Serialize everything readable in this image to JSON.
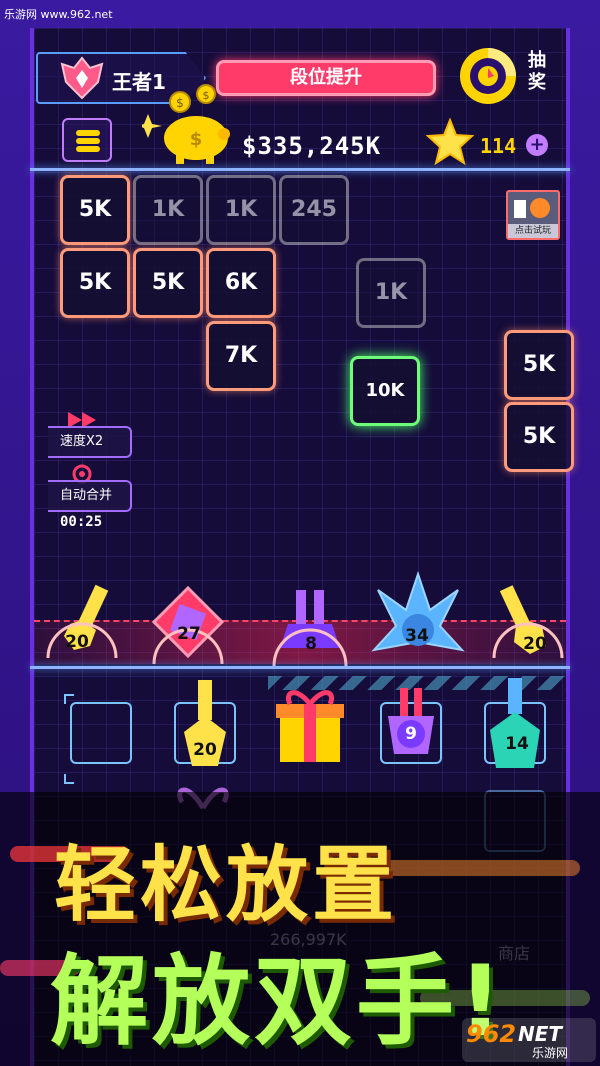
{
  "watermark_top": "乐游网 www.962.net",
  "header": {
    "rank_label": "王者1",
    "rank_up_button": "段位提升",
    "lottery_label": "抽奖",
    "money": "$335,245K",
    "gem_count": "114",
    "plus": "+"
  },
  "trial": {
    "label": "点击试玩"
  },
  "blocks": [
    {
      "label": "5K"
    },
    {
      "label": "1K"
    },
    {
      "label": "1K"
    },
    {
      "label": "245"
    },
    {
      "label": "5K"
    },
    {
      "label": "5K"
    },
    {
      "label": "6K"
    },
    {
      "label": "1K"
    },
    {
      "label": "7K"
    },
    {
      "label": "10K"
    },
    {
      "label": "5K"
    },
    {
      "label": "5K"
    }
  ],
  "side": {
    "speed_label": "速度X2",
    "auto_merge_label": "自动合并",
    "timer": "00:25"
  },
  "turrets": [
    {
      "level": "20"
    },
    {
      "level": "27"
    },
    {
      "level": "8"
    },
    {
      "level": "34"
    },
    {
      "level": "20"
    }
  ],
  "inventory": [
    {
      "level": ""
    },
    {
      "level": "20"
    },
    {
      "level": ""
    },
    {
      "level": "9"
    },
    {
      "level": "14"
    }
  ],
  "ghost": {
    "money": "266,997K",
    "shop": "商店"
  },
  "slogan": {
    "line1": "轻松放置",
    "line2": "解放双手!"
  },
  "site_logo": {
    "num": "962",
    "net": "NET",
    "cn": "乐游网"
  },
  "colors": {
    "accent_pink": "#ff3b6a",
    "accent_yellow": "#ffd400",
    "neon_blue": "#8fb4ff",
    "block_border": "#ff9a7a",
    "slogan_yellow": "#ffe24a",
    "slogan_green": "#b4ff5a"
  }
}
